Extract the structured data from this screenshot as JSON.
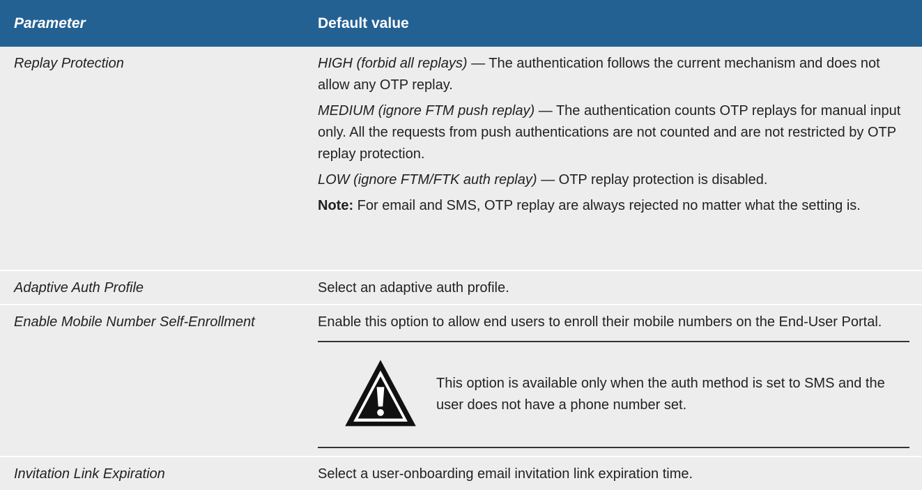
{
  "table": {
    "headers": {
      "param": "Parameter",
      "default": "Default value"
    },
    "rows": [
      {
        "param": "Replay Protection",
        "paragraphs": [
          {
            "lead": "HIGH (forbid all replays)",
            "text": " — The authentication follows the current mechanism and does not allow any OTP replay."
          },
          {
            "lead": "MEDIUM (ignore FTM push replay)",
            "text": " — The authentication counts OTP replays for manual input only. All the requests from push authentications are not counted and are not restricted by OTP replay protection."
          },
          {
            "lead": "LOW (ignore FTM/FTK auth replay)",
            "text": " — OTP replay protection is disabled."
          },
          {
            "note_label": "Note:",
            "text": " For email and SMS, OTP replay are always rejected no matter what the setting is."
          }
        ]
      },
      {
        "param": "Adaptive Auth Profile",
        "text": "Select an adaptive auth profile."
      },
      {
        "param": "Enable Mobile Number Self-Enrollment",
        "text": "Enable this option to allow end users to enroll their mobile numbers on the End-User Portal.",
        "warning": "This option is available only when the auth method is set to SMS and the user does not have a phone number set.",
        "warning_icon": "warning-triangle-icon"
      },
      {
        "param": "Invitation Link Expiration",
        "text": "Select a user-onboarding email invitation link expiration time."
      }
    ]
  },
  "colors": {
    "header_bg": "#246193",
    "row_bg": "#ededed"
  }
}
